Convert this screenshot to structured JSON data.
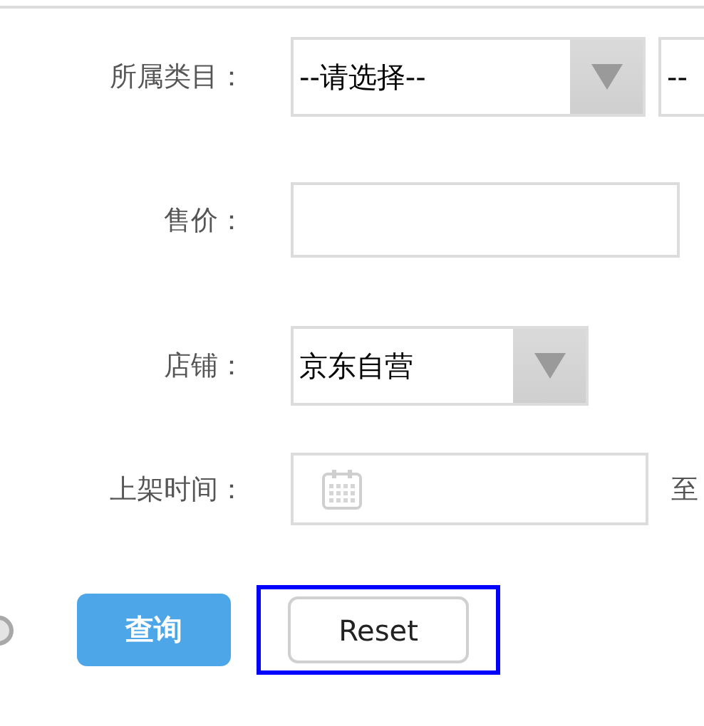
{
  "fields": [
    {
      "label": "所属类目：",
      "controls": [
        {
          "kind": "select",
          "value": "--请选择--"
        },
        {
          "kind": "select",
          "value": "--"
        }
      ]
    },
    {
      "label": "售价：",
      "controls": [
        {
          "kind": "input"
        }
      ]
    },
    {
      "label": "店铺：",
      "controls": [
        {
          "kind": "select",
          "value": "京东自营"
        }
      ]
    },
    {
      "label": "上架时间：",
      "controls": [
        {
          "kind": "date"
        },
        {
          "kind": "text",
          "text": "至"
        }
      ]
    }
  ],
  "buttons": [
    {
      "kind": "primary",
      "label": "查询",
      "highlighted": false
    },
    {
      "kind": "default",
      "label": "Reset",
      "highlighted": true
    }
  ]
}
